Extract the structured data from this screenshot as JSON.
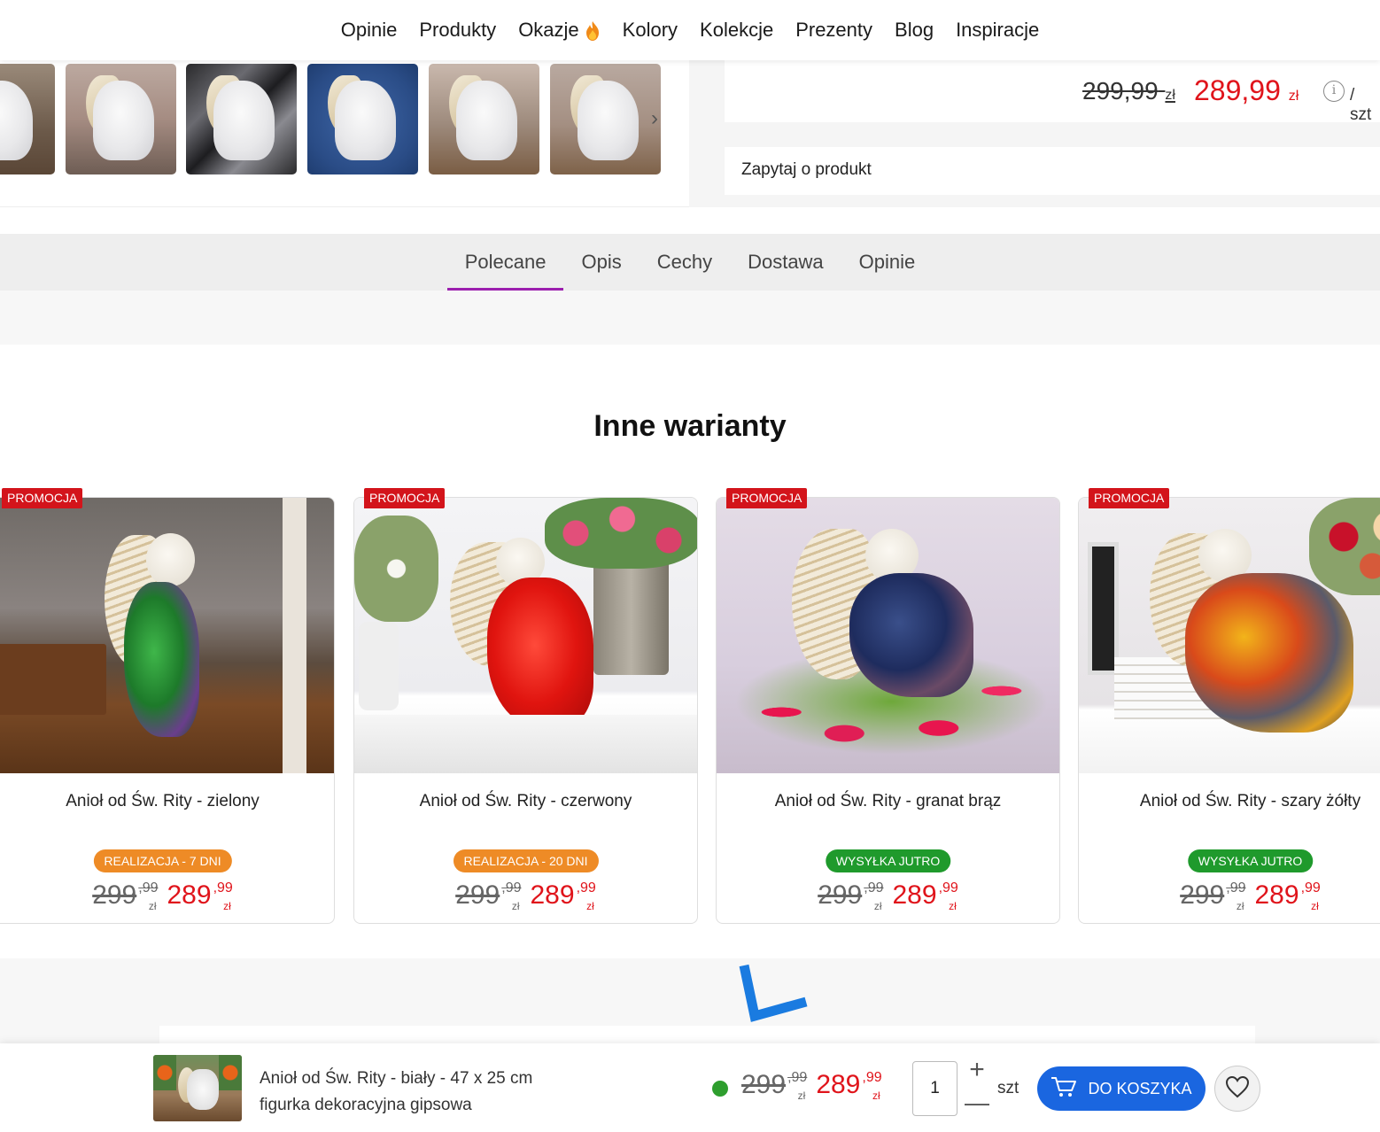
{
  "nav": {
    "items": [
      "Opinie",
      "Produkty",
      "Okazje",
      "Kolory",
      "Kolekcje",
      "Prezenty",
      "Blog",
      "Inspiracje"
    ],
    "okazje_icon": "fire-icon"
  },
  "product_top": {
    "old_price": "299,99",
    "old_currency": "zł",
    "new_price": "289,99",
    "new_currency": "zł",
    "unit": "/ szt",
    "ask_label": "Zapytaj o produkt"
  },
  "tabs": [
    {
      "label": "Polecane",
      "active": true
    },
    {
      "label": "Opis",
      "active": false
    },
    {
      "label": "Cechy",
      "active": false
    },
    {
      "label": "Dostawa",
      "active": false
    },
    {
      "label": "Opinie",
      "active": false
    }
  ],
  "variants": {
    "title": "Inne warianty",
    "items": [
      {
        "badge": "PROMOCJA",
        "name": "Anioł od Św. Rity - zielony",
        "status": "REALIZACJA - 7 DNI",
        "status_color": "#ee8b26",
        "old_main": "299",
        "old_cents": ",99",
        "old_cur": "zł",
        "new_main": "289",
        "new_cents": ",99",
        "new_cur": "zł"
      },
      {
        "badge": "PROMOCJA",
        "name": "Anioł od Św. Rity - czerwony",
        "status": "REALIZACJA - 20 DNI",
        "status_color": "#ee8b26",
        "old_main": "299",
        "old_cents": ",99",
        "old_cur": "zł",
        "new_main": "289",
        "new_cents": ",99",
        "new_cur": "zł"
      },
      {
        "badge": "PROMOCJA",
        "name": "Anioł od Św. Rity - granat brąz",
        "status": "WYSYŁKA JUTRO",
        "status_color": "#1f9a2c",
        "old_main": "299",
        "old_cents": ",99",
        "old_cur": "zł",
        "new_main": "289",
        "new_cents": ",99",
        "new_cur": "zł"
      },
      {
        "badge": "PROMOCJA",
        "name": "Anioł od Św. Rity - szary żółty",
        "status": "WYSYŁKA JUTRO",
        "status_color": "#1f9a2c",
        "old_main": "299",
        "old_cents": ",99",
        "old_cur": "zł",
        "new_main": "289",
        "new_cents": ",99",
        "new_cur": "zł"
      }
    ]
  },
  "sticky": {
    "name_line1": "Anioł od Św. Rity - biały - 47 x 25 cm",
    "name_line2": "figurka dekoracyjna gipsowa",
    "availability_color": "#2e9e2e",
    "old_main": "299",
    "old_cents": ",99",
    "old_cur": "zł",
    "new_main": "289",
    "new_cents": ",99",
    "new_cur": "zł",
    "quantity": "1",
    "plus": "+",
    "minus": "—",
    "unit": "szt",
    "cart_label": "DO KOSZYKA"
  },
  "colors": {
    "accent_purple": "#9b1fae",
    "price_red": "#e0141b",
    "cart_blue": "#1a66e0",
    "promo_red": "#d3141b"
  }
}
